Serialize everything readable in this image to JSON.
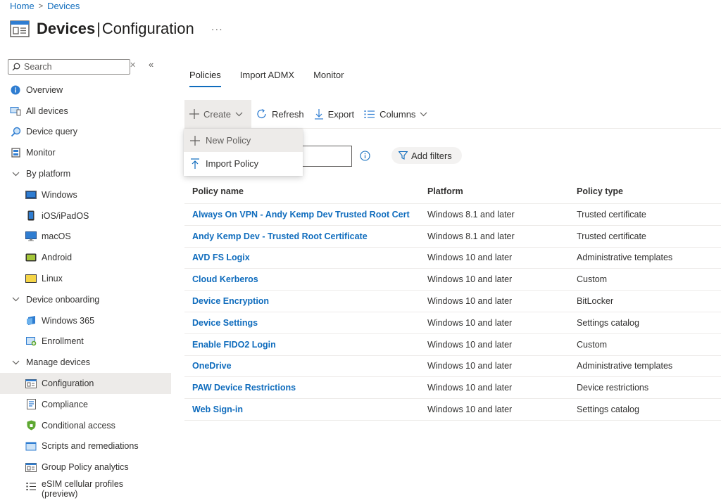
{
  "breadcrumb": {
    "home": "Home",
    "devices": "Devices"
  },
  "header": {
    "title_bold": "Devices",
    "separator": "|",
    "title_sub": "Configuration",
    "more": "···"
  },
  "sidebar": {
    "search_placeholder": "Search",
    "items": [
      {
        "label": "Overview",
        "icon": "info-icon"
      },
      {
        "label": "All devices",
        "icon": "devices-icon"
      },
      {
        "label": "Device query",
        "icon": "query-icon"
      },
      {
        "label": "Monitor",
        "icon": "monitor-icon"
      },
      {
        "label": "By platform",
        "icon": "chevron-down-icon"
      },
      {
        "label": "Windows",
        "icon": "windows-icon"
      },
      {
        "label": "iOS/iPadOS",
        "icon": "phone-icon"
      },
      {
        "label": "macOS",
        "icon": "mac-icon"
      },
      {
        "label": "Android",
        "icon": "android-icon"
      },
      {
        "label": "Linux",
        "icon": "linux-icon"
      },
      {
        "label": "Device onboarding",
        "icon": "chevron-down-icon"
      },
      {
        "label": "Windows 365",
        "icon": "windows365-icon"
      },
      {
        "label": "Enrollment",
        "icon": "enrollment-icon"
      },
      {
        "label": "Manage devices",
        "icon": "chevron-down-icon"
      },
      {
        "label": "Configuration",
        "icon": "configuration-icon"
      },
      {
        "label": "Compliance",
        "icon": "compliance-icon"
      },
      {
        "label": "Conditional access",
        "icon": "shield-icon"
      },
      {
        "label": "Scripts and remediations",
        "icon": "scripts-icon"
      },
      {
        "label": "Group Policy analytics",
        "icon": "group-policy-icon"
      },
      {
        "label": "eSIM cellular profiles (preview)",
        "icon": "list-icon"
      }
    ]
  },
  "tabs": [
    {
      "label": "Policies"
    },
    {
      "label": "Import ADMX"
    },
    {
      "label": "Monitor"
    }
  ],
  "toolbar": {
    "create": "Create",
    "refresh": "Refresh",
    "export": "Export",
    "columns": "Columns"
  },
  "dropdown": {
    "new_policy": "New Policy",
    "import_policy": "Import Policy"
  },
  "filters": {
    "add_filters": "Add filters"
  },
  "table": {
    "headers": {
      "name": "Policy name",
      "platform": "Platform",
      "type": "Policy type"
    },
    "rows": [
      {
        "name": "Always On VPN - Andy Kemp Dev Trusted Root Cert",
        "platform": "Windows 8.1 and later",
        "type": "Trusted certificate"
      },
      {
        "name": "Andy Kemp Dev - Trusted Root Certificate",
        "platform": "Windows 8.1 and later",
        "type": "Trusted certificate"
      },
      {
        "name": "AVD FS Logix",
        "platform": "Windows 10 and later",
        "type": "Administrative templates"
      },
      {
        "name": "Cloud Kerberos",
        "platform": "Windows 10 and later",
        "type": "Custom"
      },
      {
        "name": "Device Encryption",
        "platform": "Windows 10 and later",
        "type": "BitLocker"
      },
      {
        "name": "Device Settings",
        "platform": "Windows 10 and later",
        "type": "Settings catalog"
      },
      {
        "name": "Enable FIDO2 Login",
        "platform": "Windows 10 and later",
        "type": "Custom"
      },
      {
        "name": "OneDrive",
        "platform": "Windows 10 and later",
        "type": "Administrative templates"
      },
      {
        "name": "PAW Device Restrictions",
        "platform": "Windows 10 and later",
        "type": "Device restrictions"
      },
      {
        "name": "Web Sign-in",
        "platform": "Windows 10 and later",
        "type": "Settings catalog"
      }
    ]
  },
  "colors": {
    "accent": "#0f6cbd",
    "selected_bg": "#edebe9",
    "text": "#323130"
  }
}
